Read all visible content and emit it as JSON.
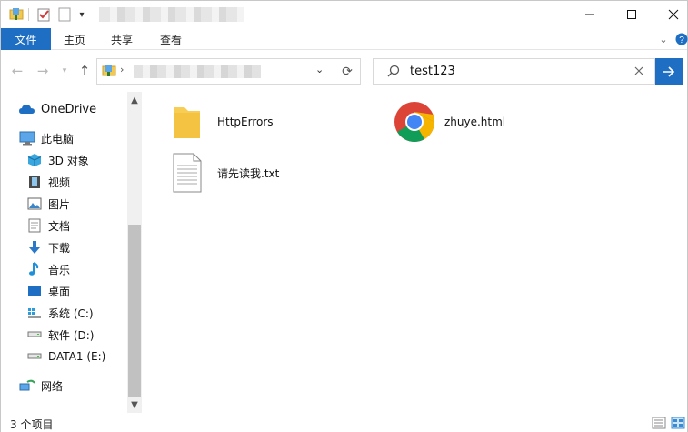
{
  "ribbon": {
    "tabs": [
      "文件",
      "主页",
      "共享",
      "查看"
    ]
  },
  "search": {
    "query": "test123"
  },
  "nav": {
    "items": [
      {
        "label": "OneDrive",
        "icon": "onedrive-icon"
      },
      {
        "label": "此电脑",
        "icon": "this-pc-icon"
      },
      {
        "label": "3D 对象",
        "icon": "3d-objects-icon"
      },
      {
        "label": "视频",
        "icon": "video-icon"
      },
      {
        "label": "图片",
        "icon": "pictures-icon"
      },
      {
        "label": "文档",
        "icon": "documents-icon"
      },
      {
        "label": "下载",
        "icon": "download-icon"
      },
      {
        "label": "音乐",
        "icon": "music-icon"
      },
      {
        "label": "桌面",
        "icon": "desktop-icon"
      },
      {
        "label": "系统 (C:)",
        "icon": "drive-c-icon"
      },
      {
        "label": "软件 (D:)",
        "icon": "drive-icon"
      },
      {
        "label": "DATA1 (E:)",
        "icon": "drive-icon"
      },
      {
        "label": "网络",
        "icon": "network-icon"
      }
    ]
  },
  "files": [
    {
      "name": "HttpErrors",
      "icon": "folder-icon"
    },
    {
      "name": "zhuye.html",
      "icon": "chrome-icon"
    },
    {
      "name": "请先读我.txt",
      "icon": "text-file-icon"
    }
  ],
  "status": {
    "count": "3 个项目"
  },
  "colors": {
    "accent": "#1e6fc4"
  }
}
